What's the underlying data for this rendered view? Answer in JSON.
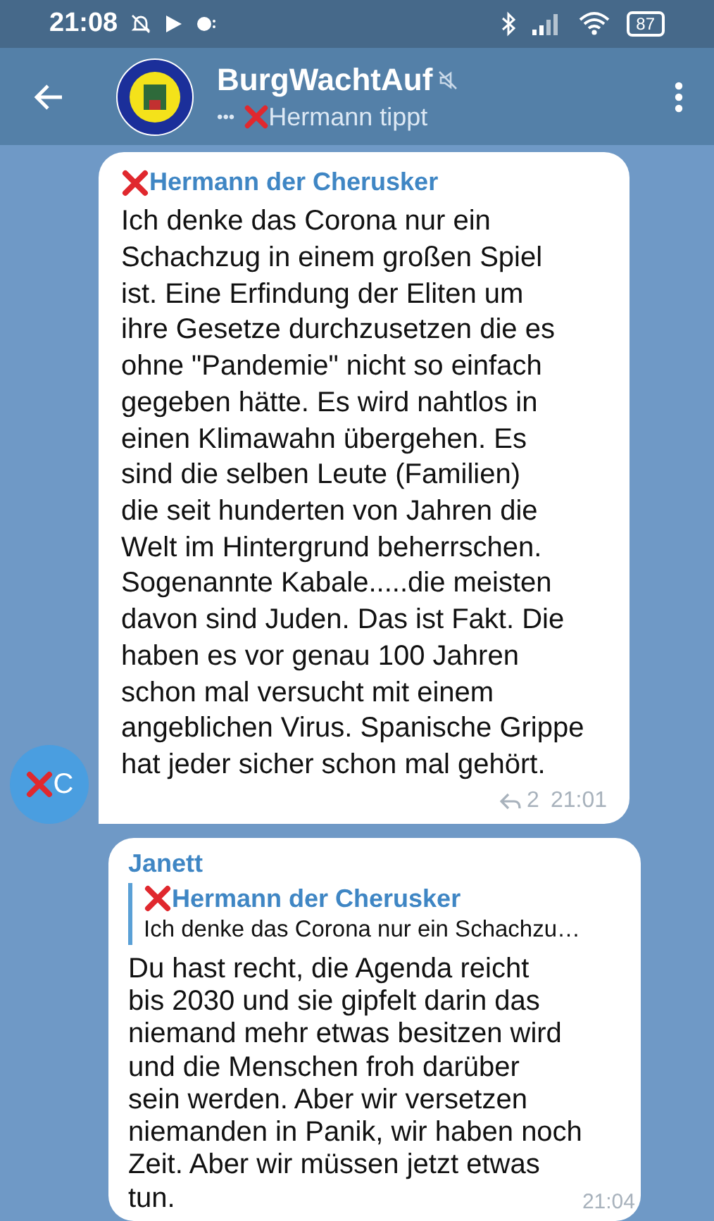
{
  "status_bar": {
    "time": "21:08",
    "battery": "87"
  },
  "header": {
    "title": "BurgWachtAuf",
    "muted": true,
    "typing_dots": "•••",
    "typing": "Hermann tippt"
  },
  "messages": [
    {
      "kind": "incoming",
      "author": "Hermann der Cherusker",
      "author_flag": true,
      "text": "Ich denke das Corona nur ein\nSchachzug in einem großen Spiel\nist. Eine Erfindung der Eliten um\nihre Gesetze durchzusetzen die es\nohne \"Pandemie\" nicht so einfach\ngegeben hätte. Es wird nahtlos in\neinen Klimawahn übergehen. Es\nsind die selben Leute (Familien)\ndie seit hunderten von Jahren die\nWelt im Hintergrund beherrschen.\nSogenannte Kabale.....die meisten\ndavon sind Juden. Das ist Fakt. Die\nhaben es vor genau 100 Jahren\nschon mal versucht mit einem\nangeblichen Virus. Spanische Grippe\nhat jeder sicher schon mal gehört.",
      "replies": "2",
      "time": "21:01",
      "avatar": {
        "initial": "C",
        "flag": true
      }
    },
    {
      "kind": "reply",
      "author": "Janett",
      "author_flag": false,
      "quote": {
        "author": "Hermann der Cherusker",
        "flag": true,
        "text": "Ich denke das Corona nur ein Schachzu…"
      },
      "text": "Du hast recht, die Agenda reicht\nbis 2030 und sie gipfelt darin das\nniemand mehr etwas besitzen wird\nund die Menschen froh darüber\nsein werden. Aber wir versetzen\nniemanden in Panik, wir haben noch\nZeit. Aber wir müssen jetzt etwas\ntun.",
      "time": "21:04"
    }
  ]
}
